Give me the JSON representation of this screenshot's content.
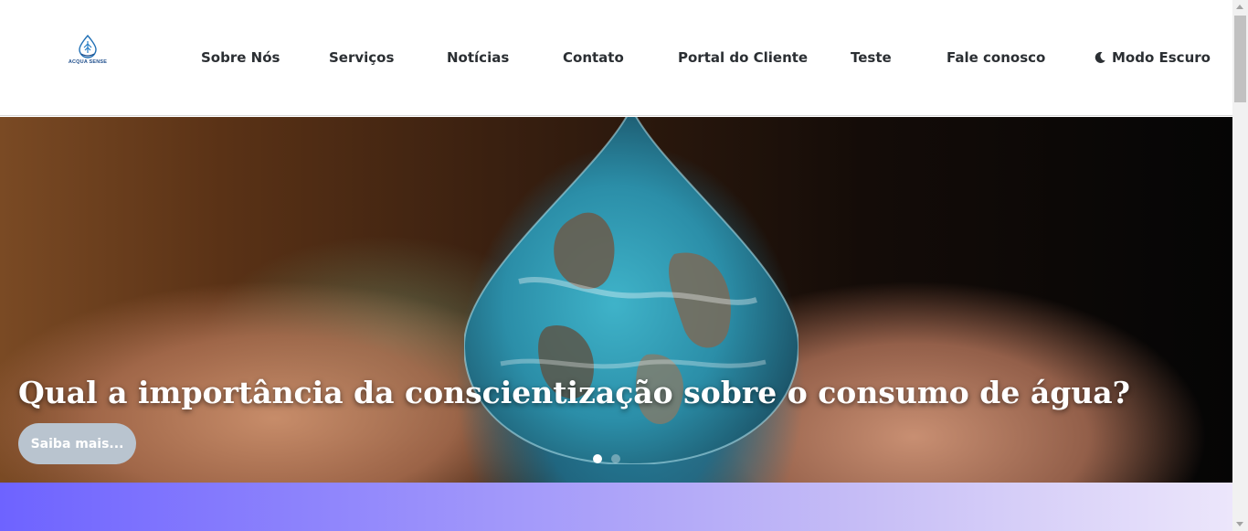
{
  "brand": {
    "logo_text": "ACQUA SENSE",
    "color": "#1f4e8c"
  },
  "nav": {
    "items": [
      {
        "label": "Sobre Nós"
      },
      {
        "label": "Serviços"
      },
      {
        "label": "Notícias"
      },
      {
        "label": "Contato"
      },
      {
        "label": "Portal do Cliente"
      },
      {
        "label": "Teste"
      },
      {
        "label": "Fale conosco"
      }
    ],
    "dark_mode": {
      "label": "Modo Escuro",
      "icon": "moon-icon"
    }
  },
  "hero": {
    "title": "Qual a importância da conscientização sobre o consumo de água?",
    "button_label": "Saiba mais...",
    "slides_total": 2,
    "active_slide": 1
  },
  "colors": {
    "button_bg": "#b9c4cf",
    "band_start": "#6e63ff",
    "band_end": "#ece6fb",
    "nav_text": "#2b2f33"
  }
}
